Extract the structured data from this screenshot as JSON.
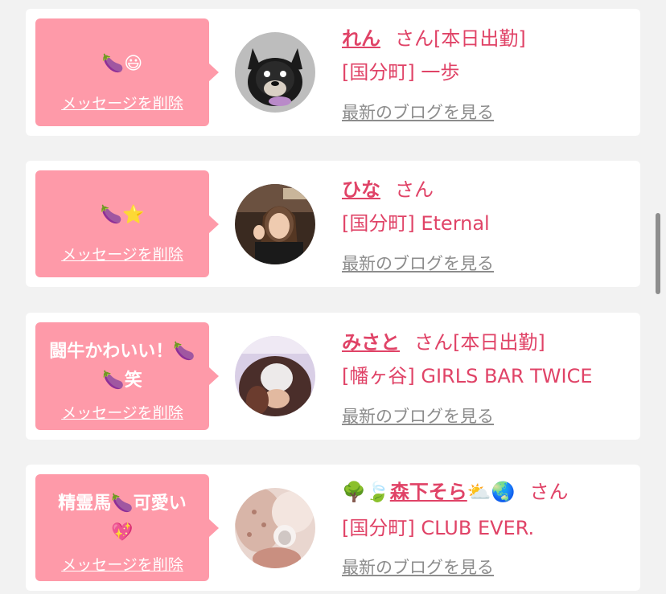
{
  "entries": [
    {
      "message": "🍆😃",
      "delete_label": "メッセージを削除",
      "name": "れん",
      "suffix": "さん[本日出勤]",
      "shop": "[国分町] 一歩",
      "blog_link": "最新のブログを見る"
    },
    {
      "message": "🍆⭐",
      "delete_label": "メッセージを削除",
      "name": "ひな",
      "suffix": "さん",
      "shop": "[国分町] Eternal",
      "blog_link": "最新のブログを見る"
    },
    {
      "message_line1": "闘牛かわいい！🍆",
      "message_line2": "🍆笑",
      "delete_label": "メッセージを削除",
      "name": "みさと",
      "suffix": "さん[本日出勤]",
      "shop": "[幡ヶ谷] GIRLS BAR TWICE",
      "blog_link": "最新のブログを見る"
    },
    {
      "message_line1": "精霊馬🍆可愛い",
      "message_line2": "💖",
      "delete_label": "メッセージを削除",
      "name_prefix": "🌳🍃",
      "name": "森下そら",
      "name_suffix_emoji": "⛅🌏",
      "suffix": "さん",
      "shop": "[国分町] CLUB EVER.",
      "blog_link": "最新のブログを見る"
    }
  ],
  "colors": {
    "accent": "#e04367",
    "bubble": "#fe9aa9",
    "link_gray": "#8c8c8c",
    "background": "#f2f2f2"
  }
}
